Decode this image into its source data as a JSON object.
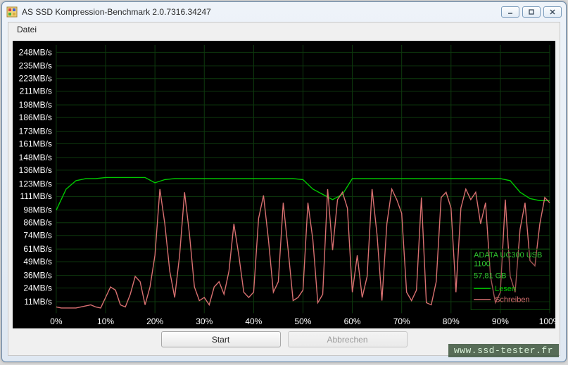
{
  "window": {
    "title": "AS SSD Kompression-Benchmark 2.0.7316.34247",
    "menu": {
      "file": "Datei"
    },
    "buttons": {
      "start": "Start",
      "cancel": "Abbrechen"
    }
  },
  "legend": {
    "device": "ADATA UC300 USB",
    "fw": "1100",
    "size": "57,81 GB",
    "read": "Lesen",
    "write": "Schreiben",
    "read_color": "#00c800",
    "write_color": "#d87070"
  },
  "watermark": "www.ssd-tester.fr",
  "chart_data": {
    "type": "line",
    "xlabel": "",
    "ylabel": "",
    "x_categories": [
      "0%",
      "10%",
      "20%",
      "30%",
      "40%",
      "50%",
      "60%",
      "70%",
      "80%",
      "90%",
      "100%"
    ],
    "y_ticks": [
      11,
      24,
      36,
      49,
      61,
      74,
      86,
      98,
      111,
      123,
      136,
      148,
      161,
      173,
      186,
      198,
      211,
      223,
      235,
      248
    ],
    "y_unit": "MB/s",
    "xlim": [
      0,
      100
    ],
    "ylim": [
      0,
      255
    ],
    "series": [
      {
        "name": "Lesen",
        "color": "#00c800",
        "x": [
          0,
          2,
          4,
          6,
          8,
          10,
          12,
          14,
          16,
          18,
          20,
          22,
          24,
          26,
          28,
          30,
          32,
          34,
          36,
          38,
          40,
          42,
          44,
          46,
          48,
          50,
          52,
          54,
          56,
          58,
          60,
          62,
          64,
          66,
          68,
          70,
          72,
          74,
          76,
          78,
          80,
          82,
          84,
          86,
          88,
          90,
          92,
          94,
          96,
          98,
          100
        ],
        "y": [
          98,
          118,
          126,
          128,
          128,
          129,
          129,
          129,
          129,
          129,
          124,
          127,
          128,
          128,
          128,
          128,
          128,
          128,
          128,
          128,
          128,
          128,
          128,
          128,
          128,
          127,
          118,
          113,
          108,
          113,
          128,
          128,
          128,
          128,
          128,
          128,
          128,
          128,
          128,
          128,
          128,
          128,
          128,
          128,
          128,
          128,
          126,
          115,
          109,
          107,
          107
        ]
      },
      {
        "name": "Schreiben",
        "color": "#d87070",
        "x": [
          0,
          1,
          2,
          3,
          4,
          5,
          6,
          7,
          8,
          9,
          10,
          11,
          12,
          13,
          14,
          15,
          16,
          17,
          18,
          19,
          20,
          21,
          22,
          23,
          24,
          25,
          26,
          27,
          28,
          29,
          30,
          31,
          32,
          33,
          34,
          35,
          36,
          37,
          38,
          39,
          40,
          41,
          42,
          43,
          44,
          45,
          46,
          47,
          48,
          49,
          50,
          51,
          52,
          53,
          54,
          55,
          56,
          57,
          58,
          59,
          60,
          61,
          62,
          63,
          64,
          65,
          66,
          67,
          68,
          69,
          70,
          71,
          72,
          73,
          74,
          75,
          76,
          77,
          78,
          79,
          80,
          81,
          82,
          83,
          84,
          85,
          86,
          87,
          88,
          89,
          90,
          91,
          92,
          93,
          94,
          95,
          96,
          97,
          98,
          99,
          100
        ],
        "y": [
          6,
          5,
          5,
          5,
          5,
          6,
          7,
          8,
          6,
          5,
          15,
          25,
          22,
          8,
          6,
          18,
          35,
          30,
          8,
          25,
          55,
          118,
          85,
          40,
          15,
          55,
          115,
          75,
          25,
          12,
          15,
          8,
          25,
          30,
          18,
          40,
          85,
          55,
          20,
          15,
          20,
          90,
          112,
          70,
          20,
          30,
          105,
          60,
          12,
          15,
          22,
          105,
          70,
          10,
          18,
          118,
          60,
          108,
          115,
          100,
          20,
          55,
          15,
          35,
          118,
          75,
          12,
          85,
          118,
          108,
          95,
          20,
          12,
          22,
          110,
          10,
          8,
          30,
          110,
          115,
          100,
          20,
          100,
          118,
          108,
          115,
          85,
          105,
          35,
          10,
          20,
          108,
          35,
          20,
          80,
          105,
          50,
          45,
          85,
          110,
          105
        ]
      }
    ]
  }
}
